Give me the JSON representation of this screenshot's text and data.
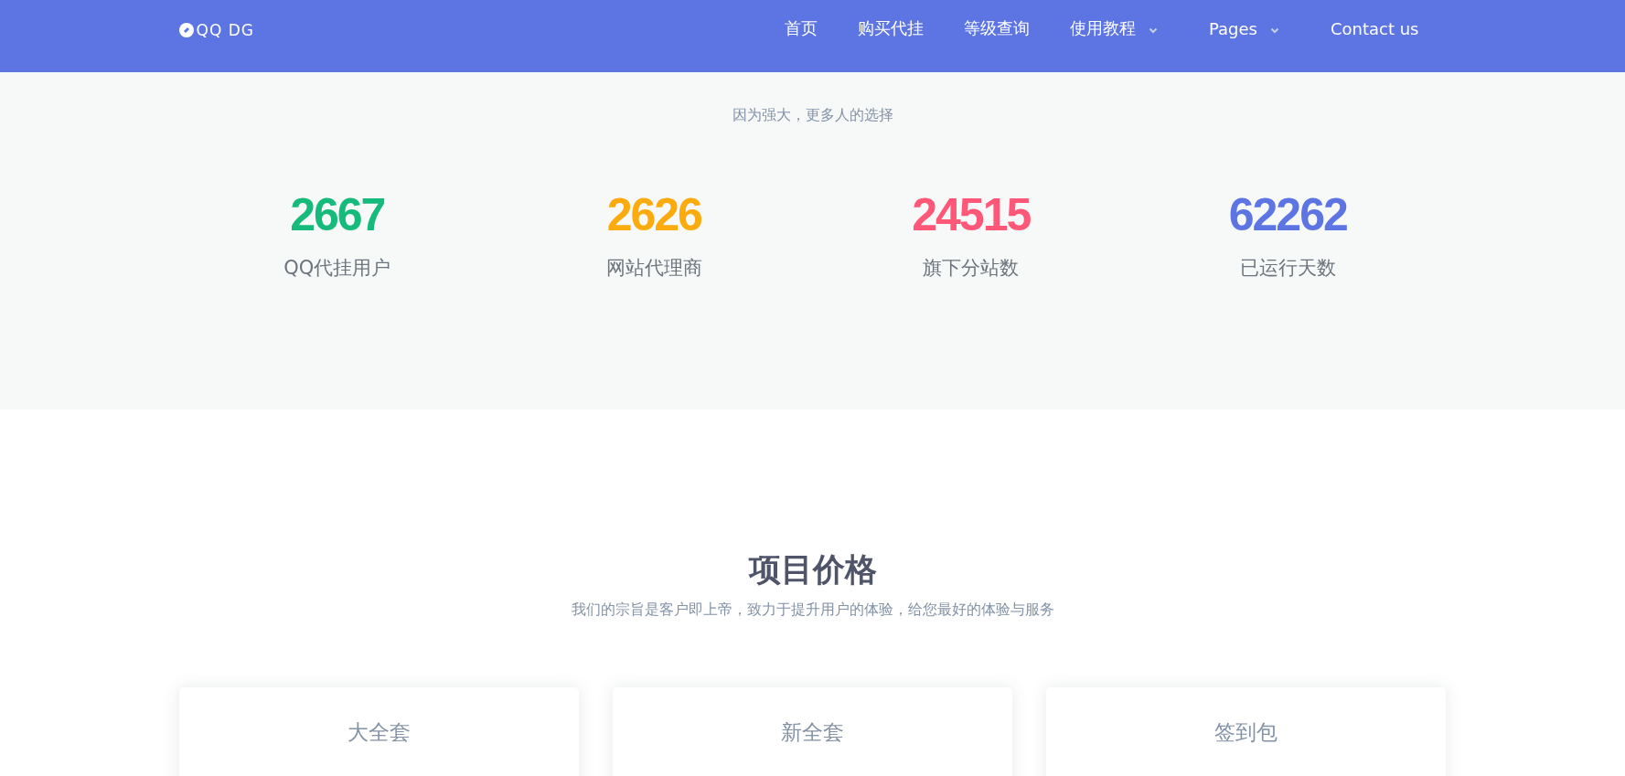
{
  "navbar": {
    "logo": "QQ DG",
    "items": [
      {
        "label": "首页",
        "dropdown": false
      },
      {
        "label": "购买代挂",
        "dropdown": false
      },
      {
        "label": "等级查询",
        "dropdown": false
      },
      {
        "label": "使用教程",
        "dropdown": true
      },
      {
        "label": "Pages",
        "dropdown": true
      },
      {
        "label": "Contact us",
        "dropdown": false
      }
    ]
  },
  "stats_section": {
    "subtitle": "因为强大，更多人的选择",
    "stats": [
      {
        "value": "2667",
        "label": "QQ代挂用户",
        "color": "#16bb7c"
      },
      {
        "value": "2626",
        "label": "网站代理商",
        "color": "#fcab0f"
      },
      {
        "value": "24515",
        "label": "旗下分站数",
        "color": "#ff5777"
      },
      {
        "value": "62262",
        "label": "已运行天数",
        "color": "#5d74e3"
      }
    ]
  },
  "pricing_section": {
    "title": "项目价格",
    "subtitle": "我们的宗旨是客户即上帝，致力于提升用户的体验，给您最好的体验与服务",
    "plans": [
      {
        "name": "大全套"
      },
      {
        "name": "新全套"
      },
      {
        "name": "签到包"
      }
    ]
  }
}
